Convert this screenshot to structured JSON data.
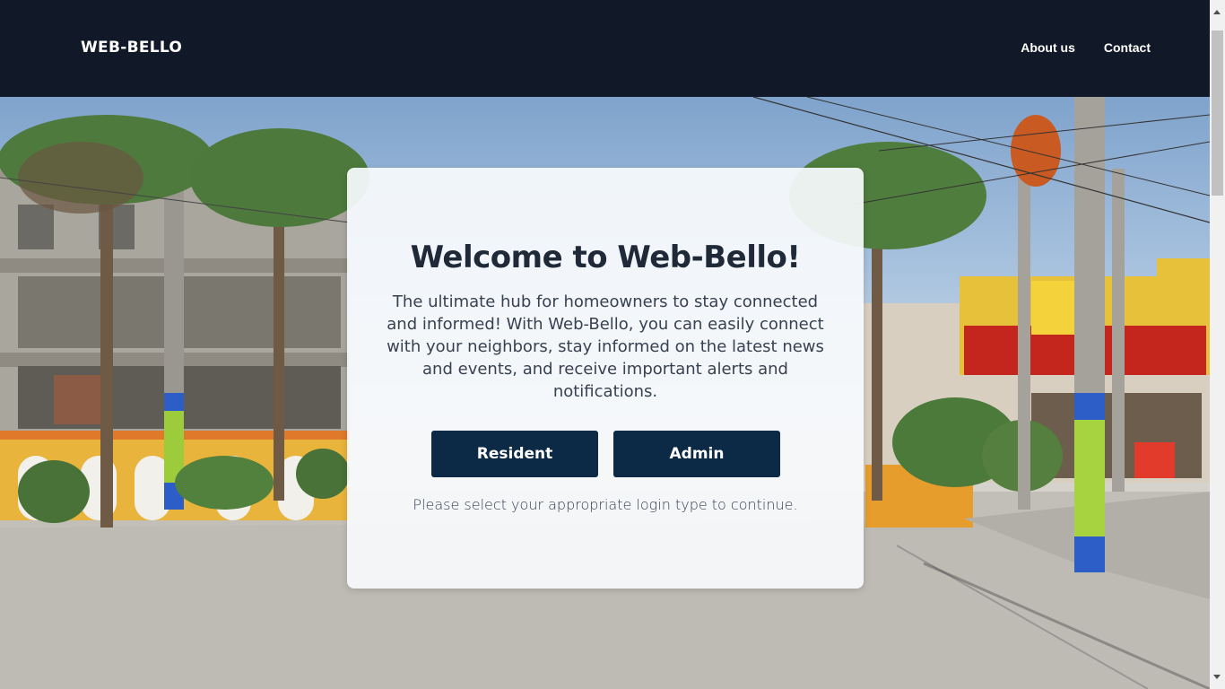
{
  "navbar": {
    "brand": "WEB-BELLO",
    "links": [
      "About us",
      "Contact"
    ]
  },
  "hero": {
    "background": "street-scene-photo"
  },
  "card": {
    "title": "Welcome to Web-Bello!",
    "description": "The ultimate hub for homeowners to stay connected and informed! With Web-Bello, you can easily connect with your neighbors, stay informed on the latest news and events, and receive important alerts and notifications.",
    "buttons": {
      "resident": "Resident",
      "admin": "Admin"
    },
    "note": "Please select your appropriate login type to continue."
  },
  "colors": {
    "navbar": "#111827",
    "button": "#0c2a45",
    "title": "#1f2937"
  }
}
